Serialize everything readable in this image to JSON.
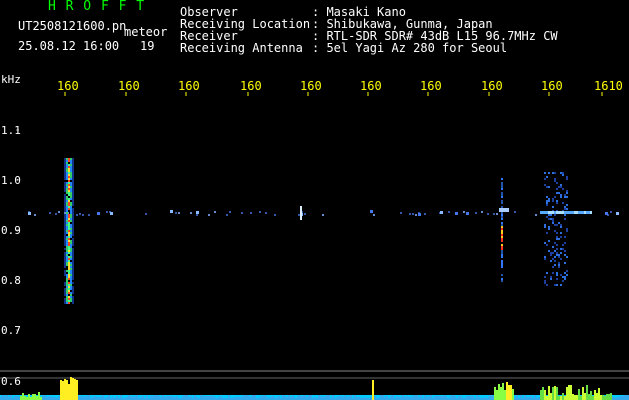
{
  "header": {
    "app_name": "H R O F F T",
    "filename": "UT2508121600.pn",
    "mode": "meteor",
    "datetime": "25.08.12 16:00",
    "count": "19",
    "labels": {
      "observer": "Observer",
      "location": "Receiving Location",
      "receiver": "Receiver",
      "antenna": "Receiving Antenna"
    },
    "values": {
      "observer": ": Masaki Kano",
      "location": ": Shibukawa, Gunma, Japan",
      "receiver": ": RTL-SDR SDR# 43dB L15 96.7MHz CW",
      "antenna": ": 5el Yagi Az 280 for Seoul"
    }
  },
  "x_axis": {
    "ticks": [
      "160",
      "160",
      "160",
      "160",
      "160",
      "160",
      "160",
      "160",
      "160",
      "1610"
    ]
  },
  "y_axis": {
    "unit": "kHz",
    "ticks": [
      "1.1",
      "1.0",
      "0.9",
      "0.8",
      "0.7",
      "0.6"
    ]
  },
  "colors": {
    "title": "#00ff00",
    "text": "#ffffff",
    "axis_label": "#ffff00",
    "background": "#000000",
    "noise_line": "#00ccff"
  }
}
